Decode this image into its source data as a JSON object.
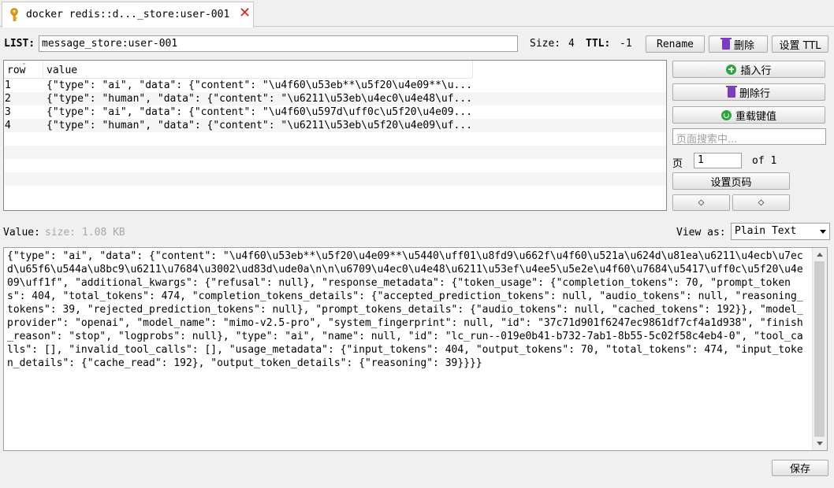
{
  "tab": {
    "title": "docker redis::d..._store:user-001",
    "icon": "key-icon"
  },
  "list": {
    "label": "LIST:",
    "key": "message_store:user-001",
    "size_label": "Size:",
    "size": "4",
    "ttl_label": "TTL:",
    "ttl": "-1"
  },
  "buttons": {
    "rename": "Rename",
    "delete": "删除",
    "set_ttl": "设置 TTL",
    "insert_row": "插入行",
    "delete_row": "删除行",
    "reload": "重载键值",
    "set_page": "设置页码",
    "prev": "◇",
    "next": "◇",
    "save": "保存"
  },
  "table": {
    "columns": [
      "row",
      "value"
    ],
    "rows": [
      {
        "row": "1",
        "value": "{\"type\": \"ai\", \"data\": {\"content\": \"\\u4f60\\u53eb**\\u5f20\\u4e09**\\u..."
      },
      {
        "row": "2",
        "value": "{\"type\": \"human\", \"data\": {\"content\": \"\\u6211\\u53eb\\u4ec0\\u4e48\\uf..."
      },
      {
        "row": "3",
        "value": "{\"type\": \"ai\", \"data\": {\"content\": \"\\u4f60\\u597d\\uff0c\\u5f20\\u4e09..."
      },
      {
        "row": "4",
        "value": "{\"type\": \"human\", \"data\": {\"content\": \"\\u6211\\u53eb\\u5f20\\u4e09\\uf..."
      }
    ]
  },
  "search": {
    "placeholder": "页面搜索中..."
  },
  "pager": {
    "page_label": "页",
    "page": "1",
    "of_label": "of 1"
  },
  "value_panel": {
    "label": "Value:",
    "size": "size: 1.08 KB",
    "view_as_label": "View as:",
    "view_as": "Plain Text",
    "content": "{\"type\": \"ai\", \"data\": {\"content\": \"\\u4f60\\u53eb**\\u5f20\\u4e09**\\u5440\\uff01\\u8fd9\\u662f\\u4f60\\u521a\\u624d\\u81ea\\u6211\\u4ecb\\u7ecd\\u65f6\\u544a\\u8bc9\\u6211\\u7684\\u3002\\ud83d\\ude0a\\n\\n\\u6709\\u4ec0\\u4e48\\u6211\\u53ef\\u4ee5\\u5e2e\\u4f60\\u7684\\u5417\\uff0c\\u5f20\\u4e09\\uff1f\", \"additional_kwargs\": {\"refusal\": null}, \"response_metadata\": {\"token_usage\": {\"completion_tokens\": 70, \"prompt_tokens\": 404, \"total_tokens\": 474, \"completion_tokens_details\": {\"accepted_prediction_tokens\": null, \"audio_tokens\": null, \"reasoning_tokens\": 39, \"rejected_prediction_tokens\": null}, \"prompt_tokens_details\": {\"audio_tokens\": null, \"cached_tokens\": 192}}, \"model_provider\": \"openai\", \"model_name\": \"mimo-v2.5-pro\", \"system_fingerprint\": null, \"id\": \"37c71d901f6247ec9861df7cf4a1d938\", \"finish_reason\": \"stop\", \"logprobs\": null}, \"type\": \"ai\", \"name\": null, \"id\": \"lc_run--019e0b41-b732-7ab1-8b55-5c02f58c4eb4-0\", \"tool_calls\": [], \"invalid_tool_calls\": [], \"usage_metadata\": {\"input_tokens\": 404, \"output_tokens\": 70, \"total_tokens\": 474, \"input_token_details\": {\"cache_read\": 192}, \"output_token_details\": {\"reasoning\": 39}}}}"
  },
  "colors": {
    "accent_green": "#2aa63a",
    "delete_purple": "#7a3fc0",
    "close_red": "#e02020"
  }
}
